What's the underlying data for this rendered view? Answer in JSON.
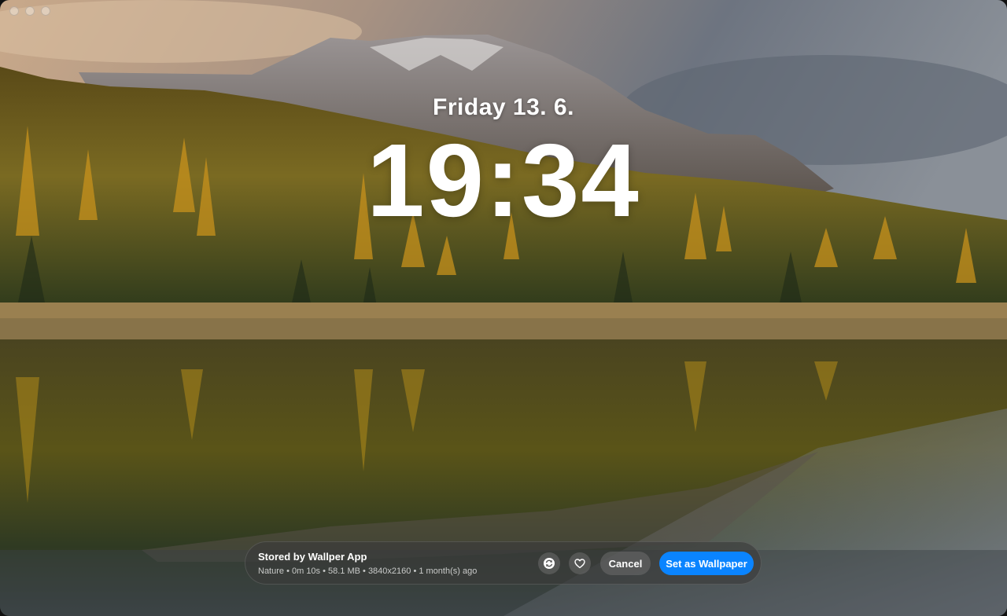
{
  "lockscreen": {
    "date": "Friday 13. 6.",
    "time": "19:34"
  },
  "panel": {
    "title": "Stored by Wallper App",
    "meta": "Nature • 0m 10s • 58.1 MB • 3840x2160 • 1 month(s) ago",
    "refresh_icon": "refresh-icon",
    "favorite_icon": "heart-icon",
    "cancel_label": "Cancel",
    "set_label": "Set as Wallpaper",
    "accent": "#0a84ff"
  }
}
